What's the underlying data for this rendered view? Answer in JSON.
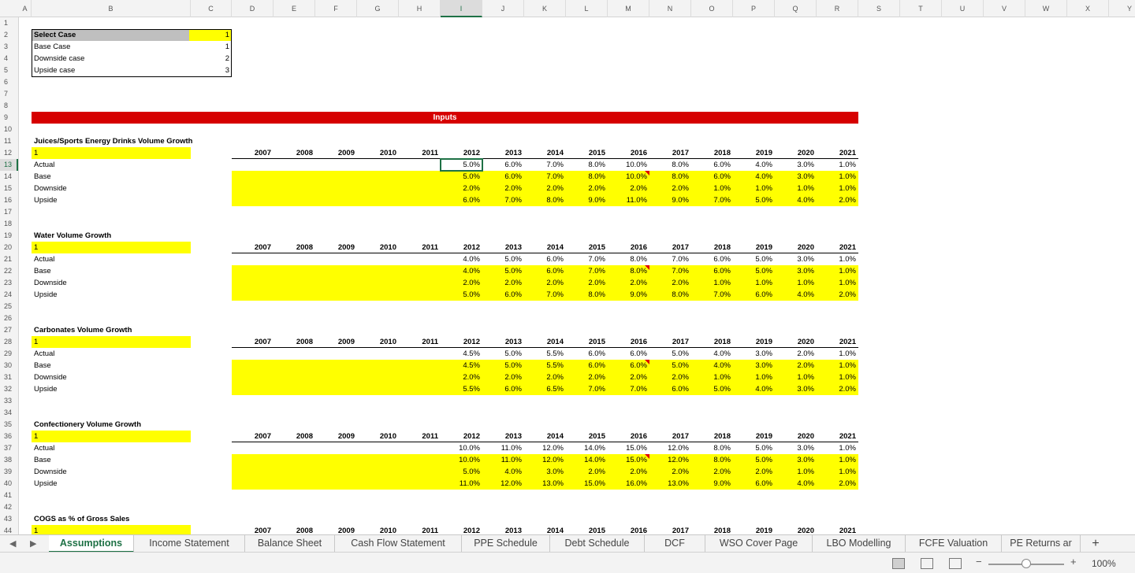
{
  "columns": [
    "A",
    "B",
    "C",
    "D",
    "E",
    "F",
    "G",
    "H",
    "I",
    "J",
    "K",
    "L",
    "M",
    "N",
    "O",
    "P",
    "Q",
    "R",
    "S",
    "T",
    "U",
    "V",
    "W",
    "X",
    "Y"
  ],
  "selected_column": "I",
  "selected_row": 13,
  "case_selector": {
    "header_label": "Select Case",
    "header_value": "1",
    "options": [
      {
        "label": "Base Case",
        "value": "1"
      },
      {
        "label": "Downside case",
        "value": "2"
      },
      {
        "label": "Upside case",
        "value": "3"
      }
    ]
  },
  "banner_label": "Inputs",
  "years": [
    "2007",
    "2008",
    "2009",
    "2010",
    "2011",
    "2012",
    "2013",
    "2014",
    "2015",
    "2016",
    "2017",
    "2018",
    "2019",
    "2020",
    "2021"
  ],
  "row_labels": [
    "Actual",
    "Base",
    "Downside",
    "Upside"
  ],
  "sections": [
    {
      "title": "Juices/Sports Energy Drinks Volume Growth",
      "case": "1",
      "rows": [
        [
          "5.0%",
          "6.0%",
          "7.0%",
          "8.0%",
          "10.0%",
          "8.0%",
          "6.0%",
          "4.0%",
          "3.0%",
          "1.0%"
        ],
        [
          "5.0%",
          "6.0%",
          "7.0%",
          "8.0%",
          "10.0%",
          "8.0%",
          "6.0%",
          "4.0%",
          "3.0%",
          "1.0%"
        ],
        [
          "2.0%",
          "2.0%",
          "2.0%",
          "2.0%",
          "2.0%",
          "2.0%",
          "1.0%",
          "1.0%",
          "1.0%",
          "1.0%"
        ],
        [
          "6.0%",
          "7.0%",
          "8.0%",
          "9.0%",
          "11.0%",
          "9.0%",
          "7.0%",
          "5.0%",
          "4.0%",
          "2.0%"
        ]
      ]
    },
    {
      "title": "Water Volume Growth",
      "case": "1",
      "rows": [
        [
          "4.0%",
          "5.0%",
          "6.0%",
          "7.0%",
          "8.0%",
          "7.0%",
          "6.0%",
          "5.0%",
          "3.0%",
          "1.0%"
        ],
        [
          "4.0%",
          "5.0%",
          "6.0%",
          "7.0%",
          "8.0%",
          "7.0%",
          "6.0%",
          "5.0%",
          "3.0%",
          "1.0%"
        ],
        [
          "2.0%",
          "2.0%",
          "2.0%",
          "2.0%",
          "2.0%",
          "2.0%",
          "1.0%",
          "1.0%",
          "1.0%",
          "1.0%"
        ],
        [
          "5.0%",
          "6.0%",
          "7.0%",
          "8.0%",
          "9.0%",
          "8.0%",
          "7.0%",
          "6.0%",
          "4.0%",
          "2.0%"
        ]
      ]
    },
    {
      "title": "Carbonates Volume Growth",
      "case": "1",
      "rows": [
        [
          "4.5%",
          "5.0%",
          "5.5%",
          "6.0%",
          "6.0%",
          "5.0%",
          "4.0%",
          "3.0%",
          "2.0%",
          "1.0%"
        ],
        [
          "4.5%",
          "5.0%",
          "5.5%",
          "6.0%",
          "6.0%",
          "5.0%",
          "4.0%",
          "3.0%",
          "2.0%",
          "1.0%"
        ],
        [
          "2.0%",
          "2.0%",
          "2.0%",
          "2.0%",
          "2.0%",
          "2.0%",
          "1.0%",
          "1.0%",
          "1.0%",
          "1.0%"
        ],
        [
          "5.5%",
          "6.0%",
          "6.5%",
          "7.0%",
          "7.0%",
          "6.0%",
          "5.0%",
          "4.0%",
          "3.0%",
          "2.0%"
        ]
      ]
    },
    {
      "title": "Confectionery Volume Growth",
      "case": "1",
      "rows": [
        [
          "10.0%",
          "11.0%",
          "12.0%",
          "14.0%",
          "15.0%",
          "12.0%",
          "8.0%",
          "5.0%",
          "3.0%",
          "1.0%"
        ],
        [
          "10.0%",
          "11.0%",
          "12.0%",
          "14.0%",
          "15.0%",
          "12.0%",
          "8.0%",
          "5.0%",
          "3.0%",
          "1.0%"
        ],
        [
          "5.0%",
          "4.0%",
          "3.0%",
          "2.0%",
          "2.0%",
          "2.0%",
          "2.0%",
          "2.0%",
          "1.0%",
          "1.0%"
        ],
        [
          "11.0%",
          "12.0%",
          "13.0%",
          "15.0%",
          "16.0%",
          "13.0%",
          "9.0%",
          "6.0%",
          "4.0%",
          "2.0%"
        ]
      ]
    },
    {
      "title": "COGS as % of Gross Sales",
      "case": "1",
      "rows": []
    }
  ],
  "sheet_tabs": [
    "Assumptions",
    "Income Statement",
    "Balance Sheet",
    "Cash Flow Statement",
    "PPE Schedule",
    "Debt Schedule",
    "DCF",
    "WSO Cover Page",
    "LBO Modelling",
    "FCFE Valuation",
    "PE Returns ar"
  ],
  "active_tab": "Assumptions",
  "add_sheet_label": "+",
  "zoom_minus": "−",
  "zoom_plus": "+",
  "zoom_level": "100%",
  "zoom_fraction": 0.5,
  "icons": {
    "nav_prev": "left-triangle",
    "nav_next": "right-triangle",
    "view_normal": "grid",
    "view_page_layout": "page",
    "view_page_break": "page-break"
  },
  "colors": {
    "accent": "#1e7145",
    "highlight": "#ffff00",
    "banner": "#d60000",
    "comment_marker": "#e00000"
  }
}
